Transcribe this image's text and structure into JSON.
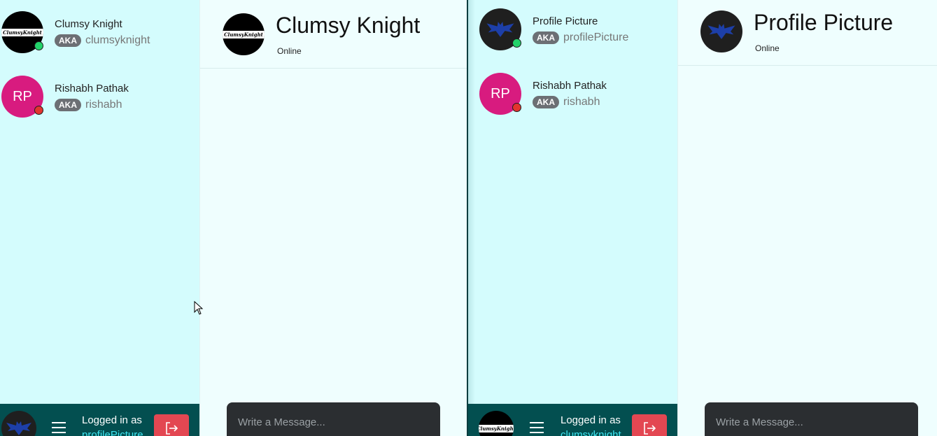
{
  "left_window": {
    "contacts": [
      {
        "name": "Clumsy Knight",
        "aka": "AKA",
        "handle": "clumsyknight",
        "avatar_text": "ClumsyKnight",
        "status": "online"
      },
      {
        "name": "Rishabh Pathak",
        "aka": "AKA",
        "handle": "rishabh",
        "avatar_text": "RP",
        "status": "offline"
      }
    ],
    "bottom_bar": {
      "logged_in_label": "Logged in as",
      "username": "profilePicture"
    },
    "chat": {
      "title": "Clumsy Knight",
      "status": "Online",
      "avatar_text": "ClumsyKnight",
      "message_placeholder": "Write a Message..."
    }
  },
  "right_window": {
    "contacts": [
      {
        "name": "Profile Picture",
        "aka": "AKA",
        "handle": "profilePicture",
        "status": "online"
      },
      {
        "name": "Rishabh Pathak",
        "aka": "AKA",
        "handle": "rishabh",
        "avatar_text": "RP",
        "status": "offline"
      }
    ],
    "bottom_bar": {
      "logged_in_label": "Logged in as",
      "username": "clumsyknight",
      "avatar_text": "ClumsyKnight"
    },
    "chat": {
      "title": "Profile Picture",
      "status": "Online",
      "message_placeholder": "Write a Message..."
    }
  },
  "colors": {
    "sidebar_bg": "#d4fcfd",
    "chat_bg": "#effefe",
    "bottom_bar_bg": "#034f50",
    "logout_button": "#e34752",
    "online_dot": "#22d36a",
    "offline_dot": "#e3342f",
    "initials_avatar": "#d81b7f",
    "composer_bg": "#2b2e31"
  },
  "icons": {
    "menu": "hamburger-icon",
    "logout": "logout-icon",
    "avatar_bat": "bat-icon"
  }
}
